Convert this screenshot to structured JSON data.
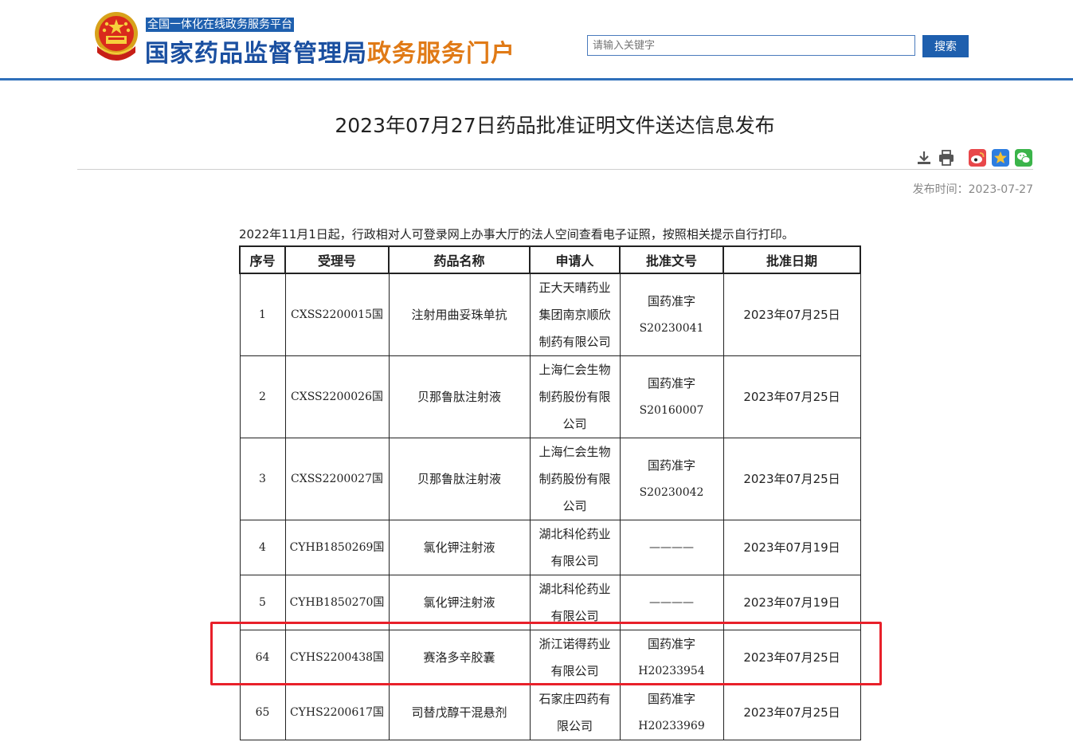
{
  "header": {
    "platform_tag": "全国一体化在线政务服务平台",
    "brand_main": "国家药品监督管理局",
    "brand_sub": "政务服务门户",
    "search_placeholder": "请输入关键字",
    "search_button": "搜索"
  },
  "article": {
    "title": "2023年07月27日药品批准证明文件送达信息发布",
    "tools": [
      "download-icon",
      "print-icon",
      "weibo-icon",
      "favorite-icon",
      "wechat-icon"
    ],
    "publish_label": "发布时间：",
    "publish_date": "2023-07-27",
    "intro": "2022年11月1日起，行政相对人可登录网上办事大厅的法人空间查看电子证照，按照相关提示自行打印。"
  },
  "table": {
    "headers": [
      "序号",
      "受理号",
      "药品名称",
      "申请人",
      "批准文号",
      "批准日期"
    ],
    "rows": [
      {
        "no": "1",
        "accept": "CXSS2200015国",
        "drug": "注射用曲妥珠单抗",
        "applicant": [
          "正大天晴药业",
          "集团南京顺欣",
          "制药有限公司"
        ],
        "approval": [
          "国药准字",
          "S20230041"
        ],
        "date": "2023年07月25日"
      },
      {
        "no": "2",
        "accept": "CXSS2200026国",
        "drug": "贝那鲁肽注射液",
        "applicant": [
          "上海仁会生物",
          "制药股份有限",
          "公司"
        ],
        "approval": [
          "国药准字",
          "S20160007"
        ],
        "date": "2023年07月25日"
      },
      {
        "no": "3",
        "accept": "CXSS2200027国",
        "drug": "贝那鲁肽注射液",
        "applicant": [
          "上海仁会生物",
          "制药股份有限",
          "公司"
        ],
        "approval": [
          "国药准字",
          "S20230042"
        ],
        "date": "2023年07月25日"
      },
      {
        "no": "4",
        "accept": "CYHB1850269国",
        "drug": "氯化钾注射液",
        "applicant": [
          "湖北科伦药业",
          "有限公司"
        ],
        "approval": [
          "————"
        ],
        "date": "2023年07月19日"
      },
      {
        "no": "5",
        "accept": "CYHB1850270国",
        "drug": "氯化钾注射液",
        "applicant": [
          "湖北科伦药业",
          "有限公司"
        ],
        "approval": [
          "————"
        ],
        "date": "2023年07月19日"
      },
      {
        "no": "64",
        "accept": "CYHS2200438国",
        "drug": "赛洛多辛胶囊",
        "applicant": [
          "浙江诺得药业",
          "有限公司"
        ],
        "approval": [
          "国药准字",
          "H20233954"
        ],
        "date": "2023年07月25日"
      },
      {
        "no": "65",
        "accept": "CYHS2200617国",
        "drug": "司替戊醇干混悬剂",
        "applicant": [
          "石家庄四药有",
          "限公司"
        ],
        "approval": [
          "国药准字",
          "H20233969"
        ],
        "date": "2023年07月25日"
      }
    ]
  },
  "colors": {
    "brand_blue": "#1a4fa0",
    "brand_orange": "#e07a16",
    "header_rule": "#2f6fba",
    "highlight": "#e8202a"
  }
}
